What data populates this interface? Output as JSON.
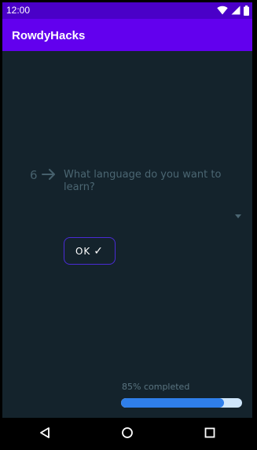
{
  "status_bar": {
    "time": "12:00",
    "icons": [
      "wifi-icon",
      "signal-icon",
      "battery-icon"
    ]
  },
  "app_bar": {
    "title": "RowdyHacks"
  },
  "question": {
    "number": "6",
    "text": "What language do you want to learn?",
    "dropdown_selected": ""
  },
  "ok_button": {
    "label": "OK",
    "check": "✓"
  },
  "progress": {
    "label": "85% completed",
    "fraction": 0.85
  },
  "nav_bar": {
    "icons": [
      "back-icon",
      "home-icon",
      "recents-icon"
    ]
  },
  "colors": {
    "status_bar": "#4a00c8",
    "app_bar": "#6200ee",
    "background": "#14232c",
    "button_border": "#4a2bd6",
    "progress_fill": "#2f7fea",
    "progress_track": "#cfe6fb"
  }
}
